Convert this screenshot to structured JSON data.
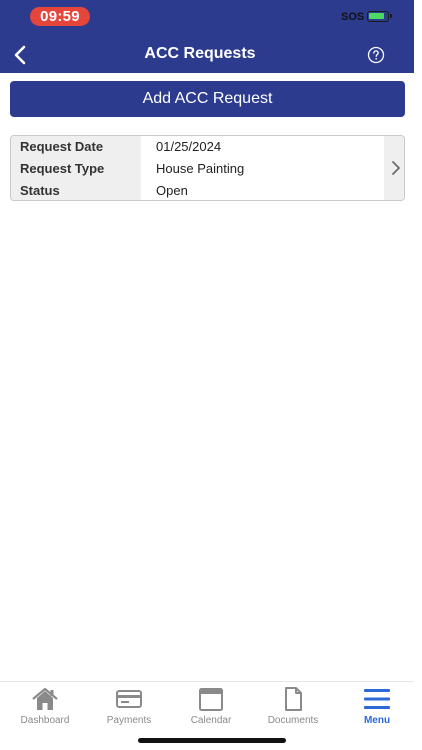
{
  "status_bar": {
    "time": "09:59",
    "sos": "SOS",
    "battery_level": 0.8,
    "charging": true,
    "colors": {
      "time_pill": "#e5453b",
      "battery_fill": "#4cd964"
    }
  },
  "header": {
    "title": "ACC Requests",
    "back_icon": "chevron-left-icon",
    "help_icon": "question-circle-icon",
    "background": "#2d3b8f"
  },
  "actions": {
    "add_label": "Add ACC Request"
  },
  "requests": [
    {
      "rows": [
        {
          "label": "Request Date",
          "value": "01/25/2024"
        },
        {
          "label": "Request Type",
          "value": "House Painting"
        },
        {
          "label": "Status",
          "value": "Open"
        }
      ],
      "chevron_icon": "chevron-right-icon"
    }
  ],
  "tab_bar": {
    "active": "Menu",
    "accent": "#2d69d6",
    "items": [
      {
        "label": "Dashboard",
        "icon": "home-icon"
      },
      {
        "label": "Payments",
        "icon": "credit-card-icon"
      },
      {
        "label": "Calendar",
        "icon": "calendar-icon"
      },
      {
        "label": "Documents",
        "icon": "document-icon"
      },
      {
        "label": "Menu",
        "icon": "hamburger-menu-icon"
      }
    ]
  }
}
